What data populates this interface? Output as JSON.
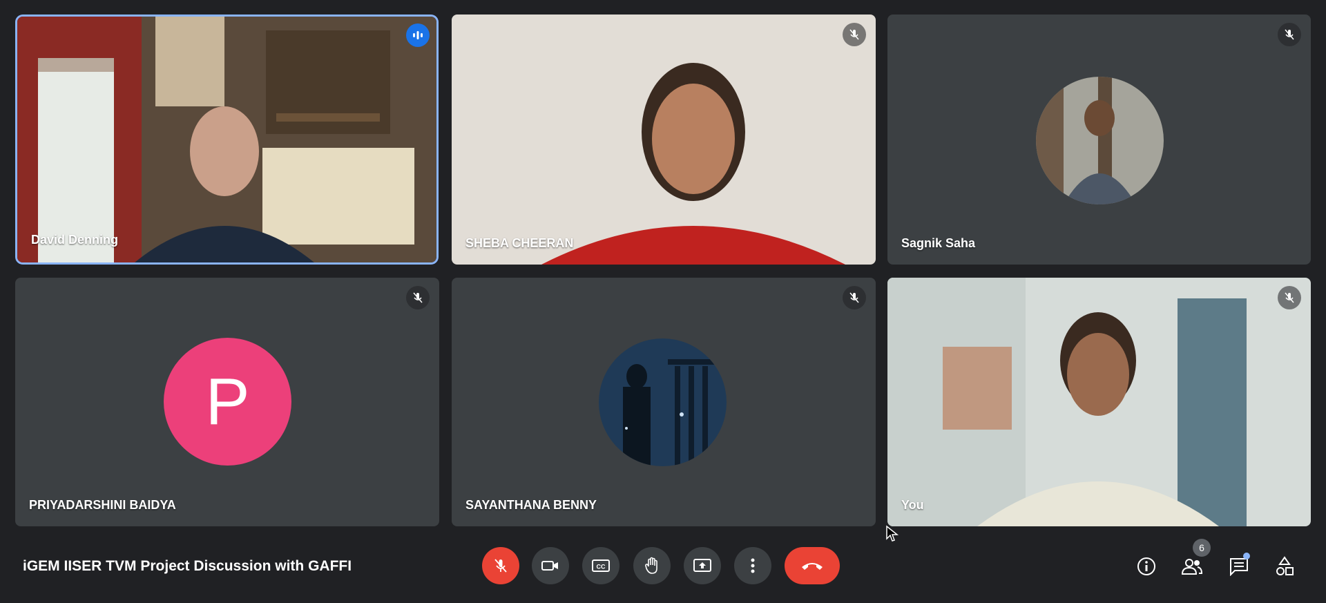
{
  "participants": [
    {
      "name": "David Denning"
    },
    {
      "name": "SHEBA CHEERAN"
    },
    {
      "name": "Sagnik Saha"
    },
    {
      "name": "PRIYADARSHINI BAIDYA",
      "avatar_letter": "P",
      "avatar_color": "#ec407a"
    },
    {
      "name": "SAYANTHANA BENNY"
    },
    {
      "name": "You"
    }
  ],
  "meeting": {
    "title": "iGEM IISER TVM Project Discussion with GAFFI"
  },
  "controls": {
    "icons": [
      "mic-off-icon",
      "camera-icon",
      "captions-icon",
      "raise-hand-icon",
      "present-icon",
      "more-options-icon",
      "end-call-icon"
    ],
    "accent_red": "#ea4335"
  },
  "right_panel": {
    "people_count": "6",
    "icons": [
      "info-icon",
      "people-icon",
      "chat-icon",
      "activities-icon"
    ]
  }
}
